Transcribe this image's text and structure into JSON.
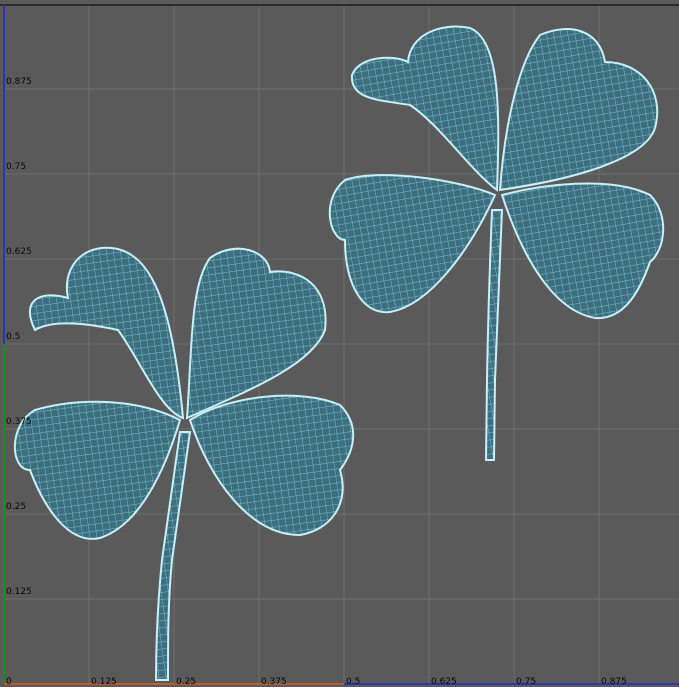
{
  "viewport": {
    "type": "uv-texture-editor",
    "background_color": "#5a5a5a",
    "grid_color": "#6e6e6e",
    "uv_range": [
      0,
      1
    ],
    "u_axis_color": "#c05a2a",
    "v_axis_color": "#2b36b8",
    "v_axis_lower_color": "#1f8a1f",
    "top_border_color": "#1a1a1a",
    "u_ticks": [
      "0",
      "0.125",
      "0.25",
      "0.375",
      "0.5",
      "0.625",
      "0.75",
      "0.875"
    ],
    "v_ticks": [
      "0",
      "0.125",
      "0.25",
      "0.375",
      "0.5",
      "0.625",
      "0.75",
      "0.875"
    ]
  },
  "uv_shells": [
    {
      "name": "clover-shell-left",
      "wire_color": "#7fd6ee",
      "fill_color": "#3f6f7e",
      "outline_color": "#c6eff8"
    },
    {
      "name": "clover-shell-right",
      "wire_color": "#7fd6ee",
      "fill_color": "#3f6f7e",
      "outline_color": "#c6eff8"
    }
  ]
}
